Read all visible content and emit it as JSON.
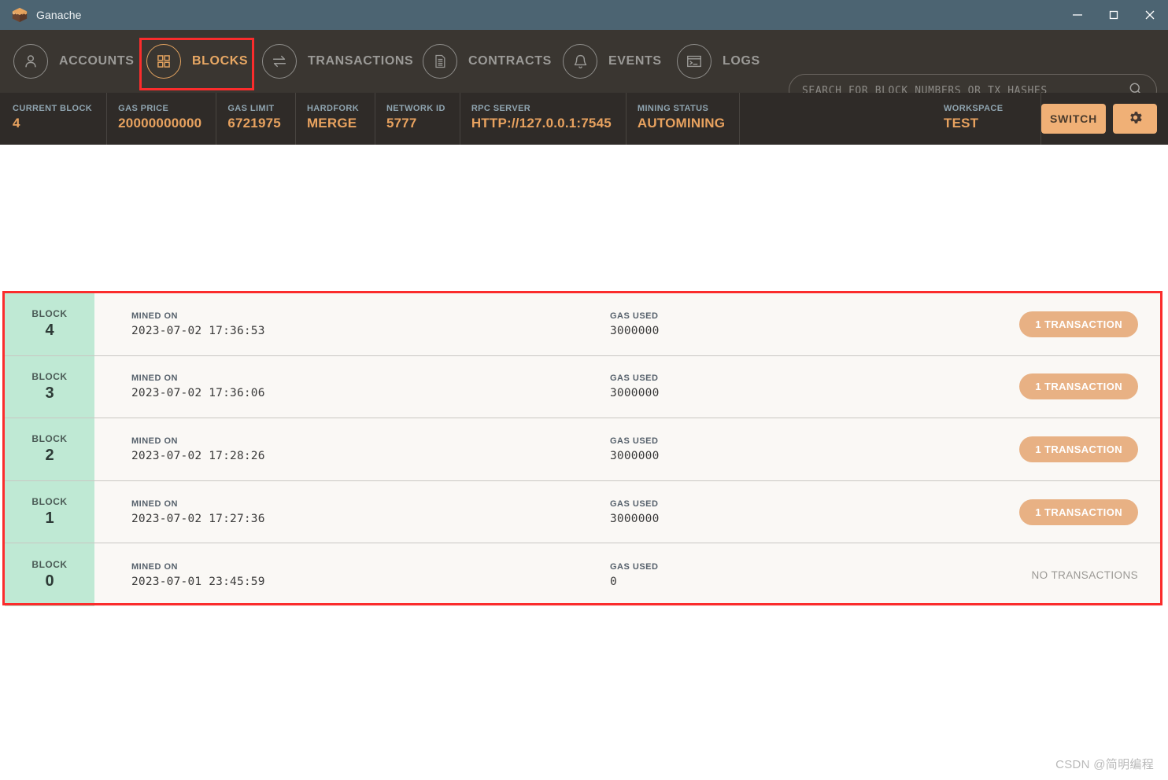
{
  "window": {
    "app_title": "Ganache",
    "logo_icon": "ganache-cube-logo",
    "controls": {
      "minimize": "minimize-icon",
      "maximize": "maximize-icon",
      "close": "close-icon"
    }
  },
  "nav": {
    "items": [
      {
        "label": "ACCOUNTS",
        "icon": "user-icon",
        "active": false
      },
      {
        "label": "BLOCKS",
        "icon": "grid-blocks-icon",
        "active": true
      },
      {
        "label": "TRANSACTIONS",
        "icon": "exchange-arrows-icon",
        "active": false
      },
      {
        "label": "CONTRACTS",
        "icon": "document-icon",
        "active": false
      },
      {
        "label": "EVENTS",
        "icon": "bell-icon",
        "active": false
      },
      {
        "label": "LOGS",
        "icon": "terminal-window-icon",
        "active": false
      }
    ],
    "search": {
      "placeholder": "SEARCH FOR BLOCK NUMBERS OR TX HASHES",
      "value": "",
      "icon": "search-icon"
    }
  },
  "status": {
    "stats": [
      {
        "label": "CURRENT BLOCK",
        "value": "4"
      },
      {
        "label": "GAS PRICE",
        "value": "20000000000"
      },
      {
        "label": "GAS LIMIT",
        "value": "6721975"
      },
      {
        "label": "HARDFORK",
        "value": "MERGE"
      },
      {
        "label": "NETWORK ID",
        "value": "5777"
      },
      {
        "label": "RPC SERVER",
        "value": "HTTP://127.0.0.1:7545"
      },
      {
        "label": "MINING STATUS",
        "value": "AUTOMINING"
      },
      {
        "label": "WORKSPACE",
        "value": "TEST"
      }
    ],
    "switch_label": "SWITCH",
    "settings_icon": "gear-icon"
  },
  "blocks": {
    "labels": {
      "block": "BLOCK",
      "mined_on": "MINED ON",
      "gas_used": "GAS USED"
    },
    "rows": [
      {
        "number": "4",
        "mined_on": "2023-07-02 17:36:53",
        "gas_used": "3000000",
        "tx_label": "1 TRANSACTION",
        "has_tx": true
      },
      {
        "number": "3",
        "mined_on": "2023-07-02 17:36:06",
        "gas_used": "3000000",
        "tx_label": "1 TRANSACTION",
        "has_tx": true
      },
      {
        "number": "2",
        "mined_on": "2023-07-02 17:28:26",
        "gas_used": "3000000",
        "tx_label": "1 TRANSACTION",
        "has_tx": true
      },
      {
        "number": "1",
        "mined_on": "2023-07-02 17:27:36",
        "gas_used": "3000000",
        "tx_label": "1 TRANSACTION",
        "has_tx": true
      },
      {
        "number": "0",
        "mined_on": "2023-07-01 23:45:59",
        "gas_used": "0",
        "tx_label": "NO TRANSACTIONS",
        "has_tx": false
      }
    ]
  },
  "watermark": {
    "text": "CSDN @简明编程"
  },
  "colors": {
    "titlebar": "#4c6472",
    "navbar": "#3a3631",
    "statusbar": "#2f2b28",
    "accent_orange": "#e8a25f",
    "button_orange": "#f0b076",
    "pill_orange": "#e8b184",
    "block_green": "#bfe9d4",
    "row_bg": "#faf8f5",
    "annotation_red": "#fb2c2c",
    "stat_label": "#8fa4b0"
  }
}
